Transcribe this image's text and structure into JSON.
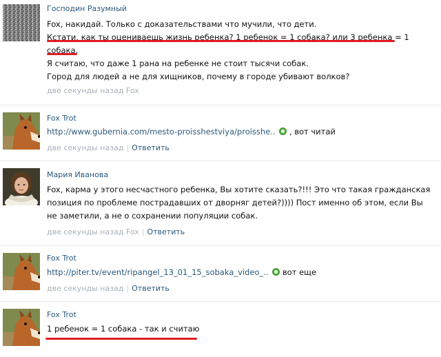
{
  "comments": [
    {
      "author": "Господин Разумный",
      "lines": [
        "Fox, накидай. Только с доказательствами что мучили, что дети.",
        "Кстати, как ты оцениваешь жизнь ребенка? 1 ребенок = 1 собака? или 3 ребенка = 1",
        "собака.",
        "Я считаю, что даже 1 рана на ребенке не стоит тысячи собак.",
        "Город для людей а не для хищников, почему в городе убивают волков?"
      ],
      "time": "две секунды назад Fox"
    },
    {
      "author": "Fox Trot",
      "link": "http://www.gubernia.com/mesto-proisshestviya/proisshe..",
      "after_link": ", вот читай",
      "time": "две секунды назад",
      "reply": "Ответить"
    },
    {
      "author": "Мария Иванова",
      "lines": [
        "Fox, карма у этого несчастного ребенка, Вы хотите сказать?!!! Это что такая гражданская",
        "позиция по проблеме пострадавших от дворняг детей?)))) Пост именно об этом, если Вы",
        "не заметили, а не о сохранении популяции собак."
      ],
      "time": "две секунды назад Fox",
      "reply": "Ответить"
    },
    {
      "author": "Fox Trot",
      "link": "http://piter.tv/event/ripangel_13_01_15_sobaka_video_..",
      "after_link": "вот еще",
      "time": "две секунды назад",
      "reply": "Ответить"
    },
    {
      "author": "Fox Trot",
      "lines": [
        "1 ребенок = 1 собака - так и считаю"
      ]
    }
  ],
  "icons": {
    "avatar_1": "noise-avatar",
    "avatar_fox": "fox-avatar",
    "avatar_maria": "portrait-avatar",
    "link_marker": "green-circle-icon"
  },
  "colors": {
    "link": "#2b587a",
    "meta": "#a9b0b8",
    "underline": "#e11b22",
    "separator": "#e4e8ee"
  }
}
